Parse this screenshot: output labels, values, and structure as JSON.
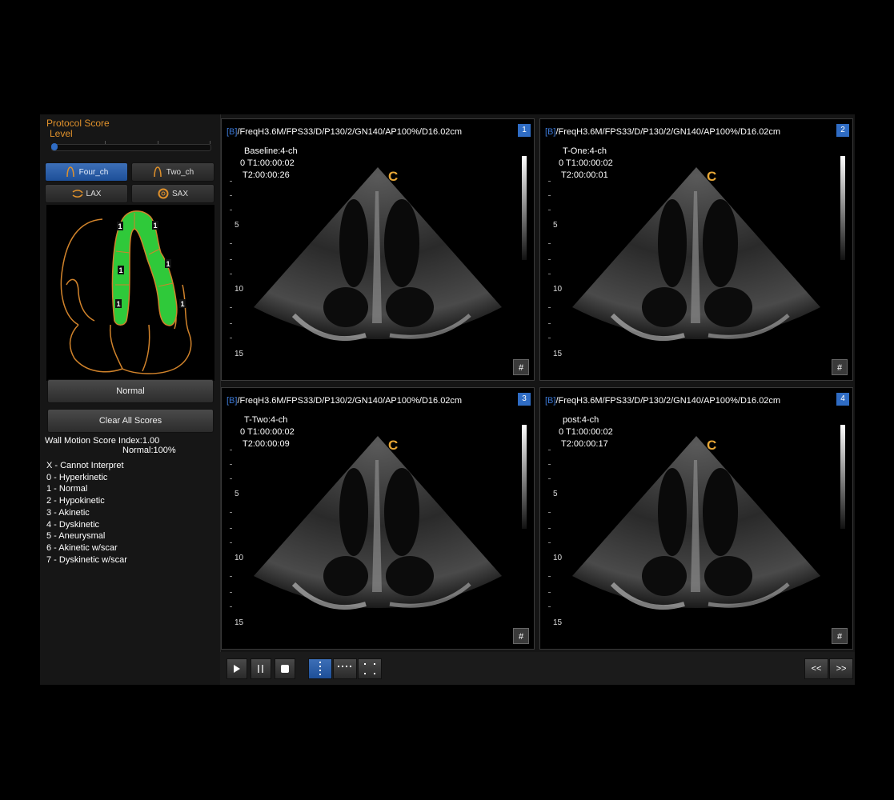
{
  "left_panel": {
    "protocol_title": "Protocol Score",
    "protocol_sub": "Level",
    "views": [
      {
        "label": "Four_ch",
        "icon": "four-chamber-icon",
        "active": true
      },
      {
        "label": "Two_ch",
        "icon": "two-chamber-icon",
        "active": false
      },
      {
        "label": "LAX",
        "icon": "lax-icon",
        "active": false
      },
      {
        "label": "SAX",
        "icon": "sax-icon",
        "active": false
      }
    ],
    "segment_scores": [
      "1",
      "1",
      "1",
      "1",
      "1",
      "1"
    ],
    "normal_button": "Normal",
    "clear_button": "Clear All Scores",
    "wms_index": "Wall Motion Score Index:1.00",
    "wms_normal": "Normal:100%",
    "legend": [
      "X - Cannot Interpret",
      "0 - Hyperkinetic",
      "1 - Normal",
      "2 - Hypokinetic",
      "3 - Akinetic",
      "4 - Dyskinetic",
      "5 - Aneurysmal",
      "6 - Akinetic w/scar",
      "7 - Dyskinetic w/scar"
    ]
  },
  "viewports": [
    {
      "num": "1",
      "b": "[B]",
      "params": "/FreqH3.6M/FPS33/D/P130/2/GN140/AP100%/D16.02cm",
      "stage": "Baseline:4-ch",
      "t1": "0 T1:00:00:02",
      "t2": "T2:00:00:26",
      "c": "C",
      "hash": "#"
    },
    {
      "num": "2",
      "b": "[B]",
      "params": "/FreqH3.6M/FPS33/D/P130/2/GN140/AP100%/D16.02cm",
      "stage": "T-One:4-ch",
      "t1": "0 T1:00:00:02",
      "t2": "T2:00:00:01",
      "c": "C",
      "hash": "#"
    },
    {
      "num": "3",
      "b": "[B]",
      "params": "/FreqH3.6M/FPS33/D/P130/2/GN140/AP100%/D16.02cm",
      "stage": "T-Two:4-ch",
      "t1": "0 T1:00:00:02",
      "t2": "T2:00:00:09",
      "c": "C",
      "hash": "#"
    },
    {
      "num": "4",
      "b": "[B]",
      "params": "/FreqH3.6M/FPS33/D/P130/2/GN140/AP100%/D16.02cm",
      "stage": "post:4-ch",
      "t1": "0 T1:00:00:02",
      "t2": "T2:00:00:17",
      "c": "C",
      "hash": "#"
    }
  ],
  "depth_labels": [
    "5",
    "10",
    "15"
  ],
  "toolbar": {
    "prev": "<<",
    "next": ">>"
  },
  "colors": {
    "accent_orange": "#e0912b",
    "accent_blue": "#2f6cc4",
    "segment_green": "#2fc93a"
  }
}
